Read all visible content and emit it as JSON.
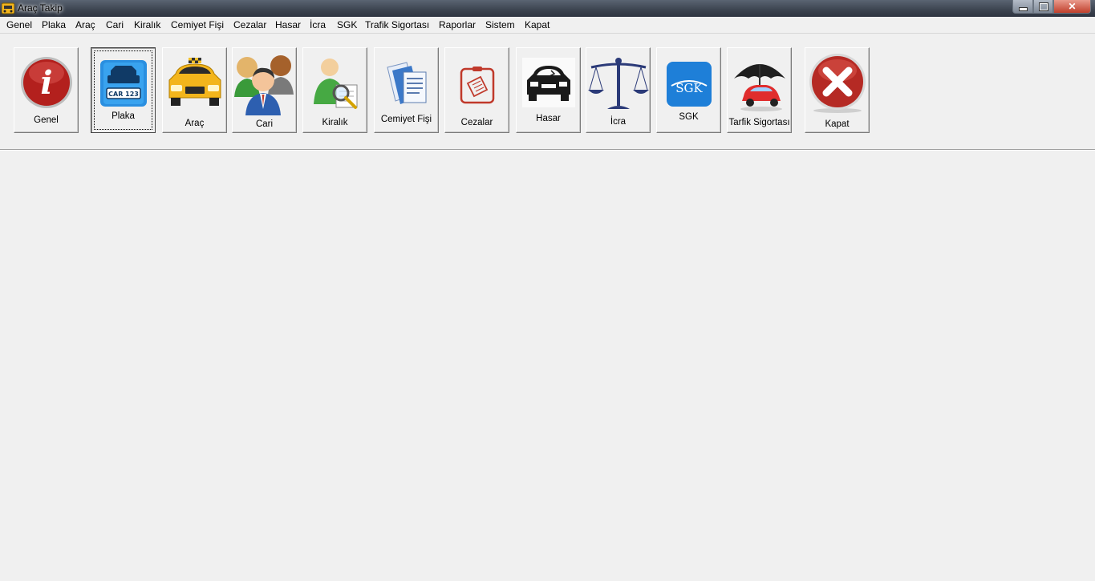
{
  "window": {
    "title": "Araç Takip"
  },
  "menu": [
    "Genel",
    "Plaka",
    "Araç",
    "Cari",
    "Kiralık",
    "Cemiyet Fişi",
    "Cezalar",
    "Hasar",
    "İcra",
    "SGK",
    "Trafik Sigortası",
    "Raporlar",
    "Sistem",
    "Kapat"
  ],
  "toolbar": [
    {
      "label": "Genel",
      "icon": "info-icon"
    },
    {
      "label": "Plaka",
      "icon": "license-plate-icon",
      "pressed": true
    },
    {
      "label": "Araç",
      "icon": "taxi-icon"
    },
    {
      "label": "Cari",
      "icon": "people-icon"
    },
    {
      "label": "Kiralık",
      "icon": "person-search-icon"
    },
    {
      "label": "Cemiyet Fişi",
      "icon": "documents-icon"
    },
    {
      "label": "Cezalar",
      "icon": "ticket-icon"
    },
    {
      "label": "Hasar",
      "icon": "damaged-car-icon"
    },
    {
      "label": "İcra",
      "icon": "scales-icon"
    },
    {
      "label": "SGK",
      "icon": "sgk-logo-icon"
    },
    {
      "label": "Tarfik Sigortası",
      "icon": "umbrella-car-icon"
    },
    {
      "label": "Kapat",
      "icon": "close-x-icon"
    }
  ],
  "plate_text": "CAR 123",
  "sgk_logo_text": "SGK",
  "colors": {
    "titlebar": "#3e4652",
    "background": "#f0f0f0",
    "close_red": "#c0392b",
    "sgk_blue": "#1e7fd8"
  }
}
